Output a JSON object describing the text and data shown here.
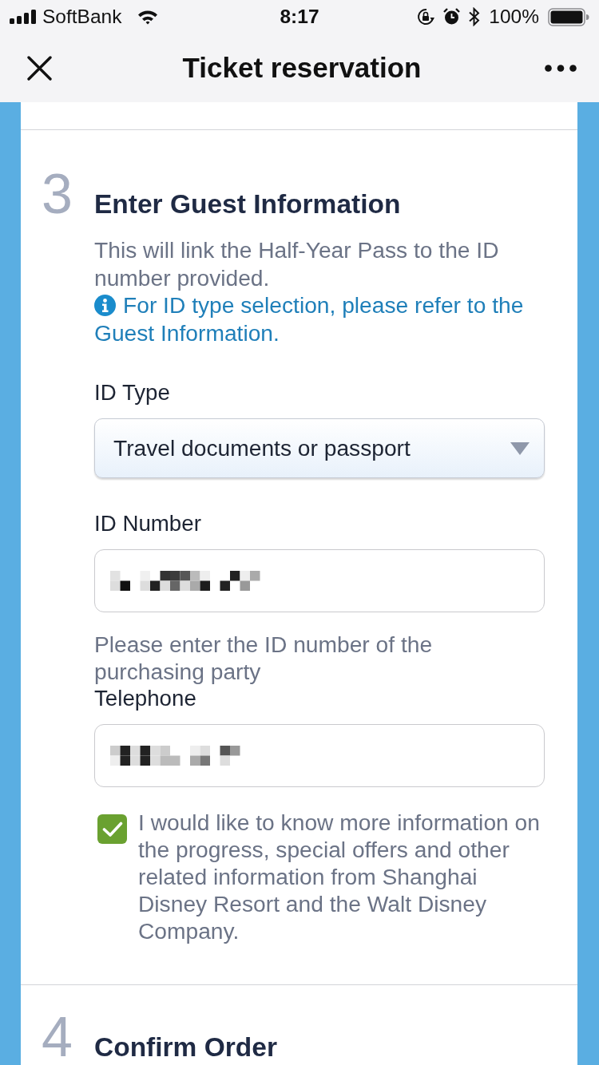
{
  "status_bar": {
    "carrier": "SoftBank",
    "time": "8:17",
    "battery": "100%"
  },
  "nav_bar": {
    "title": "Ticket reservation"
  },
  "sections": [
    {
      "number": "3",
      "title": "Enter Guest Information",
      "description": "This will link the Half-Year Pass to the ID number provided.",
      "info_link": "For ID type selection, please refer to the Guest Information.",
      "fields": [
        {
          "kind": "select",
          "label": "ID Type",
          "value": "Travel documents or passport"
        },
        {
          "kind": "input",
          "label": "ID Number",
          "redacted": true,
          "help_text": "Please enter the ID number of the purchasing party"
        },
        {
          "kind": "input",
          "label": "Telephone",
          "redacted": true
        }
      ],
      "consent": {
        "checked": true,
        "text": "I would like to know more information on the progress, special offers and other related information from Shanghai Disney Resort and the Walt Disney Company."
      }
    },
    {
      "number": "4",
      "title": "Confirm Order"
    }
  ]
}
